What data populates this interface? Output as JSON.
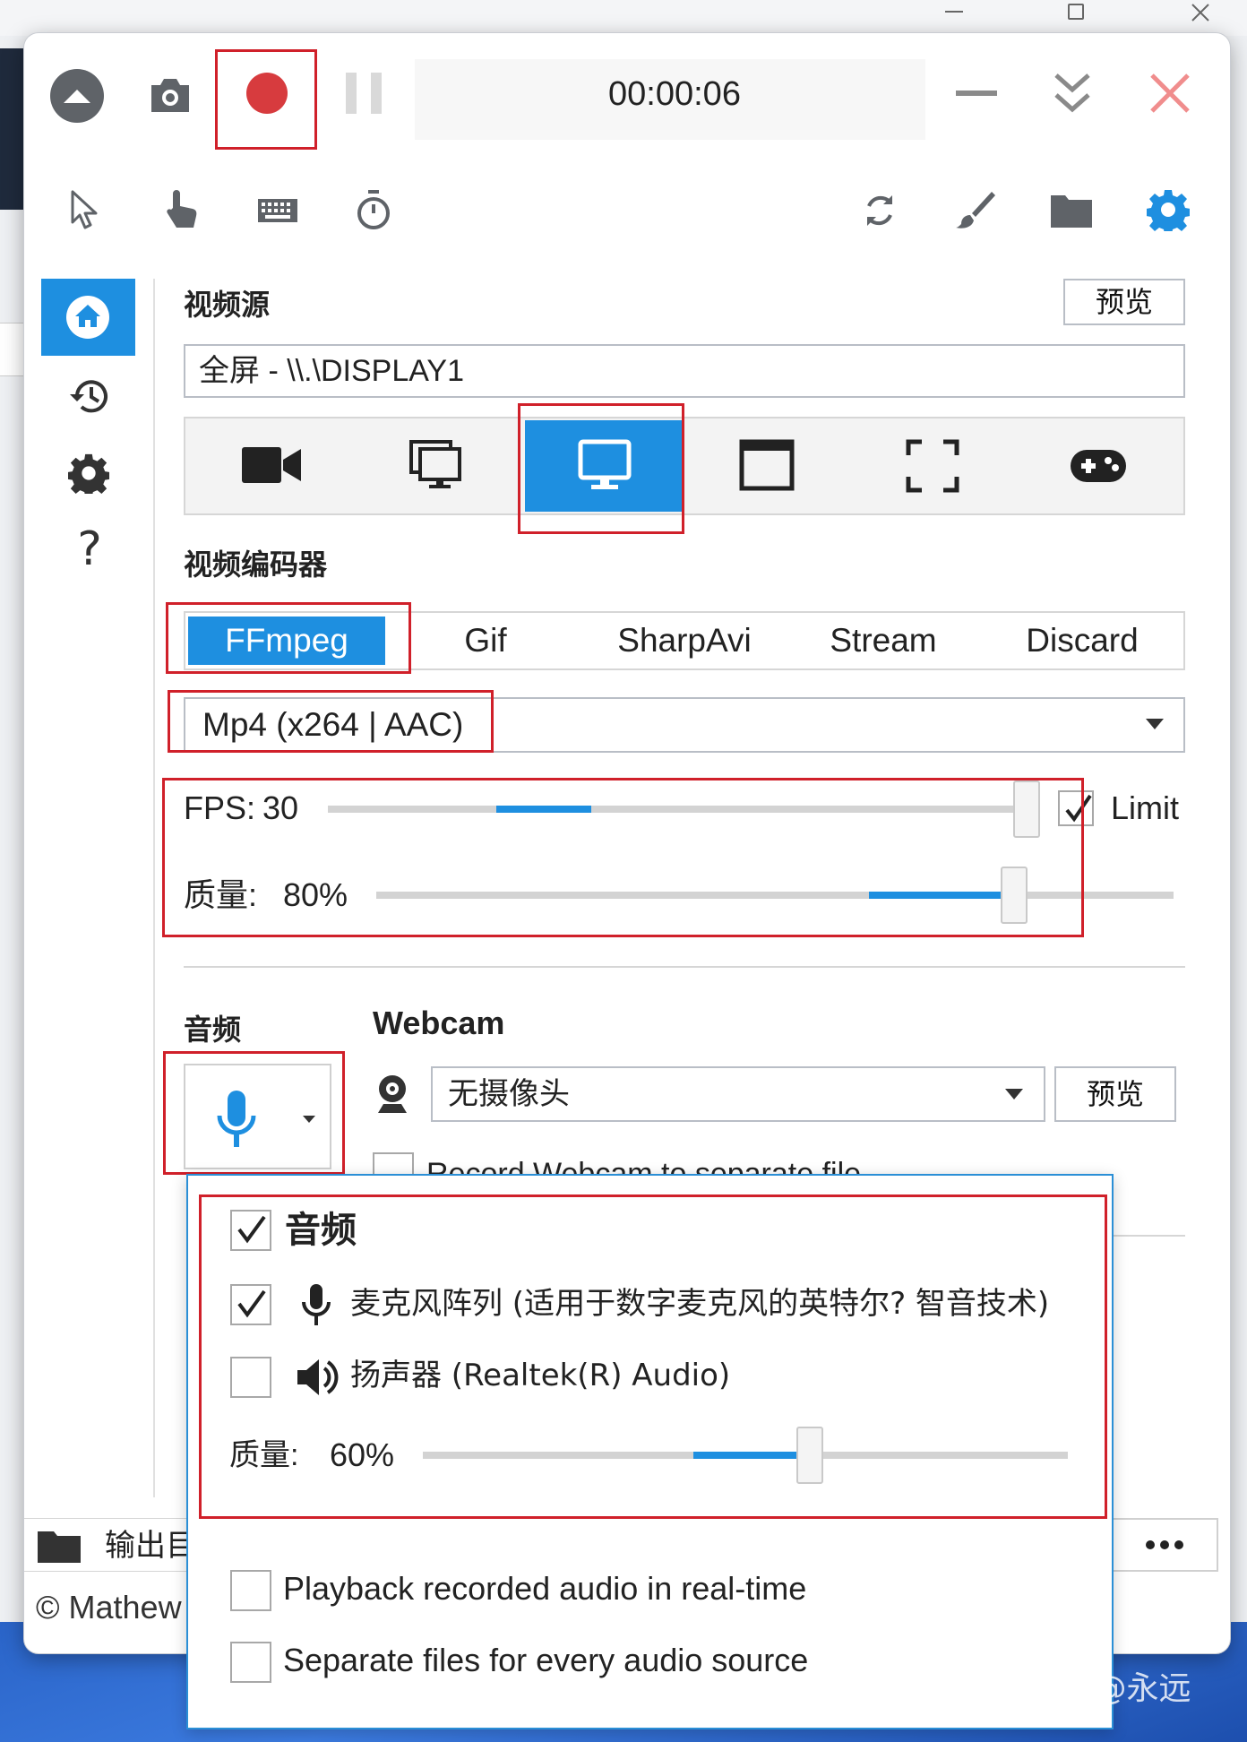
{
  "titlebar": {
    "timer": "00:00:06"
  },
  "video_source": {
    "title": "视频源",
    "preview_label": "预览",
    "source_value": "全屏 - \\\\.\\DISPLAY1"
  },
  "video_encoder": {
    "title": "视频编码器",
    "tabs": [
      "FFmpeg",
      "Gif",
      "SharpAvi",
      "Stream",
      "Discard"
    ],
    "selected_tab": "FFmpeg",
    "format_value": "Mp4 (x264 | AAC)"
  },
  "fps": {
    "label": "FPS:",
    "value": "30",
    "level": 0.33,
    "limit_label": "Limit",
    "limit_checked": true
  },
  "quality": {
    "label": "质量:",
    "value": "80%",
    "level": 0.8
  },
  "audio": {
    "title": "音频"
  },
  "webcam": {
    "title": "Webcam",
    "value": "无摄像头",
    "preview_label": "预览",
    "separate_file_label": "Record Webcam to separate file"
  },
  "audio_popup": {
    "title": "音频",
    "title_checked": true,
    "devices": [
      {
        "label": "麦克风阵列 (适用于数字麦克风的英特尔? 智音技术)",
        "checked": true,
        "icon": "microphone-icon"
      },
      {
        "label": "扬声器 (Realtek(R) Audio)",
        "checked": false,
        "icon": "speaker-icon"
      }
    ],
    "quality_label": "质量:",
    "quality_value": "60%",
    "quality_level": 0.6,
    "options": [
      {
        "label": "Playback recorded audio in real-time",
        "checked": false
      },
      {
        "label": "Separate files for every audio source",
        "checked": false
      }
    ]
  },
  "footer": {
    "output_label": "输出目",
    "copyright": "© Mathew"
  },
  "watermark": "知乎 @永远",
  "colors": {
    "accent": "#1e8fe0",
    "record": "#d73b3e",
    "close": "#f08d8d",
    "highlight_border": "#d0202a"
  }
}
